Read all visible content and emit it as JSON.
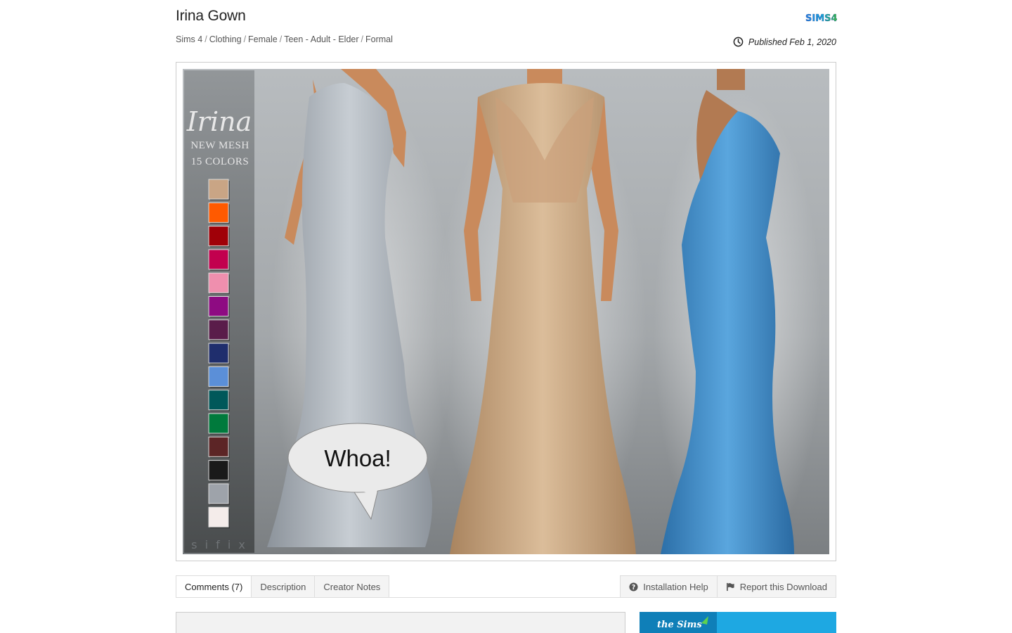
{
  "page": {
    "title": "Irina Gown",
    "breadcrumb": [
      "Sims 4",
      "Clothing",
      "Female",
      "Teen - Adult - Elder",
      "Formal"
    ],
    "breadcrumb_separator": "/",
    "published": "Published Feb 1, 2020",
    "game_logo_text": "SIMS4"
  },
  "preview": {
    "overlay_title": "Irina",
    "overlay_line1": "NEW MESH",
    "overlay_line2": "15 COLORS",
    "watermark": "s i f i x",
    "speech_bubble": "Whoa!",
    "swatches": [
      "#c9a585",
      "#ff5a00",
      "#a00008",
      "#c2004e",
      "#ef8fae",
      "#8e0b82",
      "#5a1d4a",
      "#1f2e6d",
      "#5b8fd8",
      "#00585a",
      "#007a3c",
      "#5c2526",
      "#1a1a1a",
      "#9ea3aa",
      "#f4ecea"
    ],
    "gown_colors": {
      "left": "#a9b0b8",
      "center": "#c9a27c",
      "right": "#3f8ec8"
    }
  },
  "tabs": [
    {
      "label": "Comments (7)",
      "active": true
    },
    {
      "label": "Description",
      "active": false
    },
    {
      "label": "Creator Notes",
      "active": false
    }
  ],
  "actions": {
    "installation_help": "Installation Help",
    "report": "Report this Download"
  },
  "ad": {
    "text": "the Sims"
  }
}
